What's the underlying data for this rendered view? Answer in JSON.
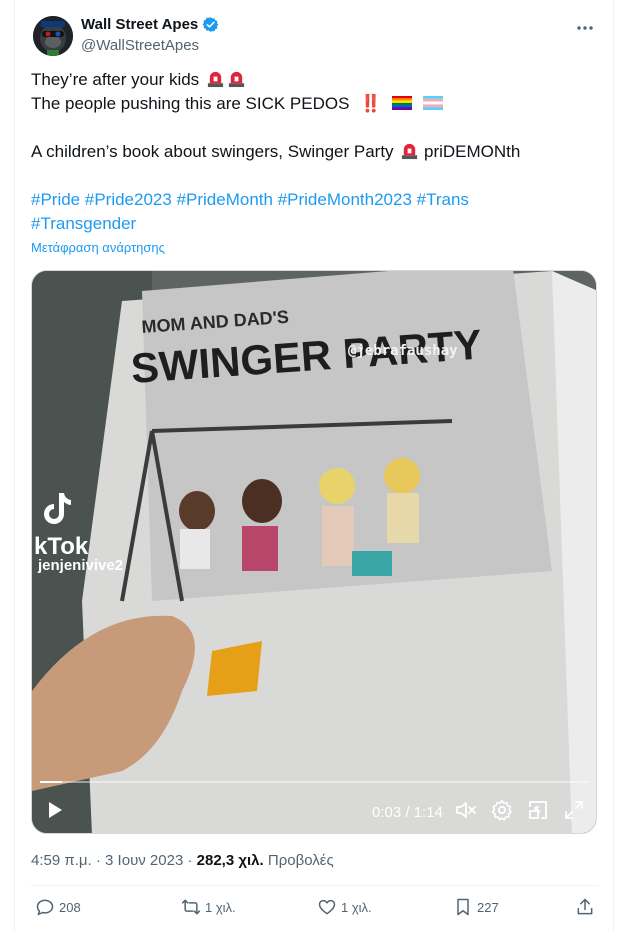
{
  "author": {
    "display_name": "Wall Street Apes",
    "handle": "@WallStreetApes",
    "avatar_icon": "gorilla-avatar",
    "verified_icon": "verified-badge-icon",
    "verified_color": "#1d9bf0"
  },
  "tweet": {
    "line1": "They’re after your kids",
    "line2": "The people pushing this are SICK PEDOS",
    "line2_bang": "‼️",
    "line3_start": "A children’s book about swingers, Swinger Party",
    "line3_end": "priDEMONth",
    "hashtags_line1": [
      "#Pride",
      "#Pride2023",
      "#PrideMonth",
      "#PrideMonth2023",
      "#Trans"
    ],
    "hashtags_line2": [
      "#Transgender"
    ],
    "translate_label": "Μετάφραση ανάρτησης"
  },
  "video": {
    "overlay_tag": "@jebrafaushay",
    "tiktok_word": "kTok",
    "tiktok_user": "jenjenivive2",
    "book_title_top": "MOM AND DAD'S",
    "book_title_main": "SWINGER PARTY",
    "time_display": "0:03 / 1:14",
    "progress": 0.04,
    "play_icon": "play-icon",
    "mute_icon": "volume-muted-icon",
    "settings_icon": "gear-icon",
    "pip_icon": "picture-in-picture-icon",
    "fullscreen_icon": "fullscreen-icon"
  },
  "meta": {
    "time": "4:59 π.μ.",
    "separator": " · ",
    "date": "3 Ιουν 2023",
    "views_count": "282,3 χιλ.",
    "views_label": "Προβολές"
  },
  "actions": {
    "replies": "208",
    "reposts": "1 χιλ.",
    "likes": "1 χιλ.",
    "bookmarks": "227"
  },
  "colors": {
    "link": "#1d9bf0",
    "secondary_text": "#536471",
    "primary_text": "#0f1419"
  }
}
